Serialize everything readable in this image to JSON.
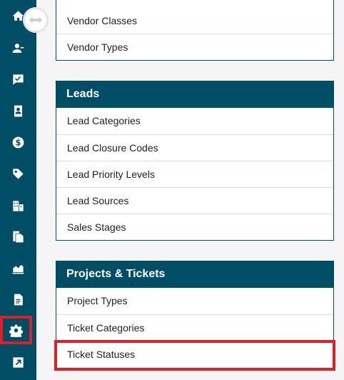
{
  "sidebar": {
    "items": [
      {
        "icon": "home-icon",
        "name": "nav-home"
      },
      {
        "icon": "contacts-icon",
        "name": "nav-contacts"
      },
      {
        "icon": "chat-check-icon",
        "name": "nav-tasks"
      },
      {
        "icon": "address-book-icon",
        "name": "nav-address-book"
      },
      {
        "icon": "dollar-icon",
        "name": "nav-finance"
      },
      {
        "icon": "tag-icon",
        "name": "nav-leads"
      },
      {
        "icon": "buildings-icon",
        "name": "nav-companies"
      },
      {
        "icon": "documents-icon",
        "name": "nav-documents"
      },
      {
        "icon": "chart-icon",
        "name": "nav-reports"
      },
      {
        "icon": "file-icon",
        "name": "nav-files"
      },
      {
        "icon": "gear-icon",
        "name": "nav-settings",
        "highlighted": true
      },
      {
        "icon": "external-link-icon",
        "name": "nav-external"
      }
    ],
    "toggle_icon": "collapse-toggle-icon"
  },
  "vendors_card": {
    "items": [
      "Vendor Classes",
      "Vendor Types"
    ]
  },
  "leads_card": {
    "title": "Leads",
    "items": [
      "Lead Categories",
      "Lead Closure Codes",
      "Lead Priority Levels",
      "Lead Sources",
      "Sales Stages"
    ]
  },
  "projects_card": {
    "title": "Projects & Tickets",
    "items": [
      "Project Types",
      "Ticket Categories",
      "Ticket Statuses"
    ],
    "highlighted_item": "Ticket Statuses"
  },
  "colors": {
    "sidebar_bg": "#004d66",
    "header_bg": "#004d66",
    "highlight": "#e01e26"
  }
}
